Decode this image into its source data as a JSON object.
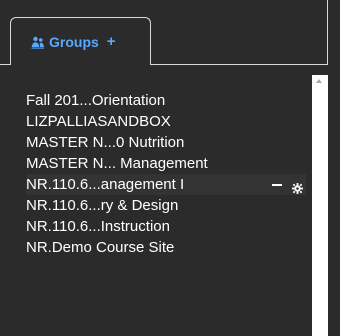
{
  "tabs": [
    {
      "label": "Groups",
      "icon": "group-icon",
      "add_icon": "+"
    }
  ],
  "groups": [
    {
      "label": "Fall 201...Orientation"
    },
    {
      "label": "LIZPALLIASANDBOX"
    },
    {
      "label": "MASTER N...0 Nutrition"
    },
    {
      "label": "MASTER N... Management"
    },
    {
      "label": "NR.110.6...anagement I",
      "active": true,
      "actions": [
        "minus-icon",
        "gear-icon"
      ]
    },
    {
      "label": "NR.110.6...ry & Design"
    },
    {
      "label": "NR.110.6...Instruction"
    },
    {
      "label": "NR.Demo Course Site"
    }
  ],
  "colors": {
    "background": "#2b2b2b",
    "accent": "#5aa9ff",
    "text": "#ffffff",
    "border": "#d9d9d9"
  }
}
